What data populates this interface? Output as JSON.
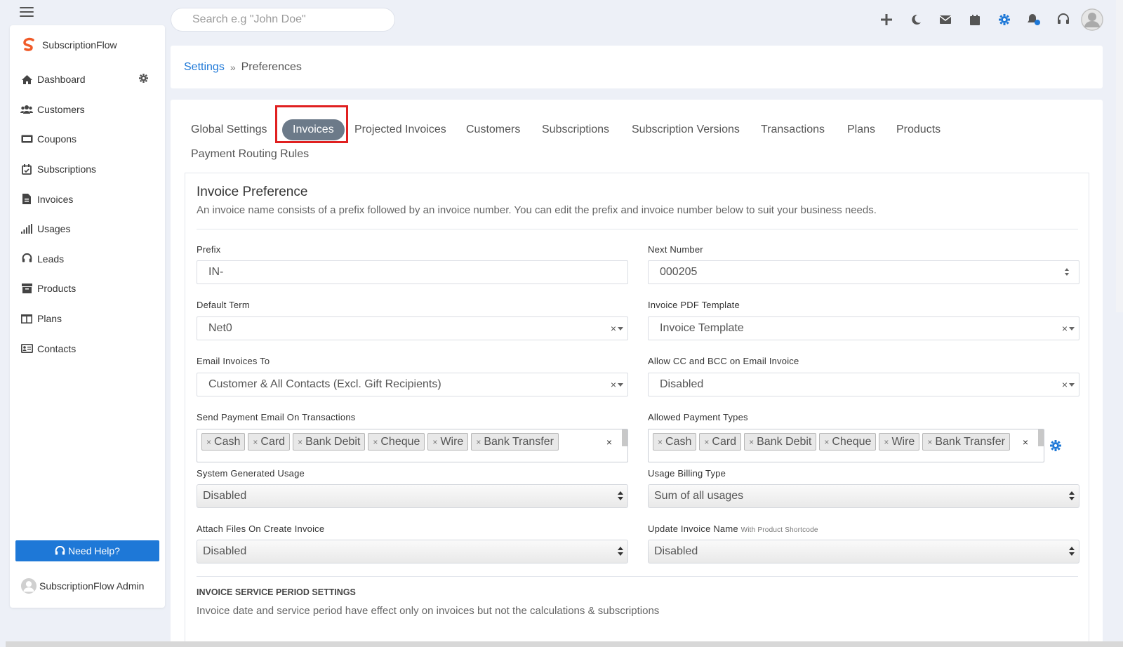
{
  "header": {
    "search_placeholder": "Search e.g \"John Doe\"",
    "icons": [
      "plus-icon",
      "moon-icon",
      "mail-icon",
      "calendar-icon",
      "gear-icon",
      "bell-icon",
      "headset-icon",
      "avatar"
    ]
  },
  "sidebar": {
    "brand": "SubscriptionFlow",
    "items": [
      {
        "label": "Dashboard",
        "icon": "home-icon"
      },
      {
        "label": "Customers",
        "icon": "users-icon"
      },
      {
        "label": "Coupons",
        "icon": "ticket-icon"
      },
      {
        "label": "Subscriptions",
        "icon": "calendar-check-icon"
      },
      {
        "label": "Invoices",
        "icon": "invoice-icon"
      },
      {
        "label": "Usages",
        "icon": "bars-icon"
      },
      {
        "label": "Leads",
        "icon": "headset-icon"
      },
      {
        "label": "Products",
        "icon": "archive-icon"
      },
      {
        "label": "Plans",
        "icon": "columns-icon"
      },
      {
        "label": "Contacts",
        "icon": "contact-card-icon"
      }
    ],
    "help_button": "Need Help?",
    "user_name": "SubscriptionFlow Admin"
  },
  "breadcrumb": {
    "parent": "Settings",
    "separator": "»",
    "current": "Preferences"
  },
  "tabs": [
    "Global Settings",
    "Invoices",
    "Projected Invoices",
    "Customers",
    "Subscriptions",
    "Subscription Versions",
    "Transactions",
    "Plans",
    "Products",
    "Payment Routing Rules"
  ],
  "active_tab": "Invoices",
  "preference": {
    "title": "Invoice Preference",
    "description": "An invoice name consists of a prefix followed by an invoice number. You can edit the prefix and invoice number below to suit your business needs.",
    "fields": {
      "prefix": {
        "label": "Prefix",
        "value": "IN-"
      },
      "next_number": {
        "label": "Next Number",
        "value": "000205"
      },
      "default_term": {
        "label": "Default Term",
        "value": "Net0"
      },
      "pdf_template": {
        "label": "Invoice PDF Template",
        "value": "Invoice Template"
      },
      "email_to": {
        "label": "Email Invoices To",
        "value": "Customer & All Contacts (Excl. Gift Recipients)"
      },
      "allow_cc": {
        "label": "Allow CC and BCC on Email Invoice",
        "value": "Disabled"
      },
      "send_payment_email": {
        "label": "Send Payment Email On Transactions",
        "chips": [
          "Cash",
          "Card",
          "Bank Debit",
          "Cheque",
          "Wire",
          "Bank Transfer"
        ]
      },
      "allowed_payment_types": {
        "label": "Allowed Payment Types",
        "chips": [
          "Cash",
          "Card",
          "Bank Debit",
          "Cheque",
          "Wire",
          "Bank Transfer"
        ]
      },
      "system_usage": {
        "label": "System Generated Usage",
        "value": "Disabled"
      },
      "usage_billing": {
        "label": "Usage Billing Type",
        "value": "Sum of all usages"
      },
      "attach_files": {
        "label": "Attach Files On Create Invoice",
        "value": "Disabled"
      },
      "update_name": {
        "label": "Update Invoice Name",
        "hint": "With Product Shortcode",
        "value": "Disabled"
      }
    },
    "chip_remove": "×",
    "clear_symbol": "×"
  },
  "service_period": {
    "title": "INVOICE SERVICE PERIOD SETTINGS",
    "description": "Invoice date and service period have effect only on invoices but not the calculations & subscriptions"
  },
  "colors": {
    "accent": "#1e78d7",
    "active_tab": "#6c7a89",
    "highlight": "#e02020"
  }
}
